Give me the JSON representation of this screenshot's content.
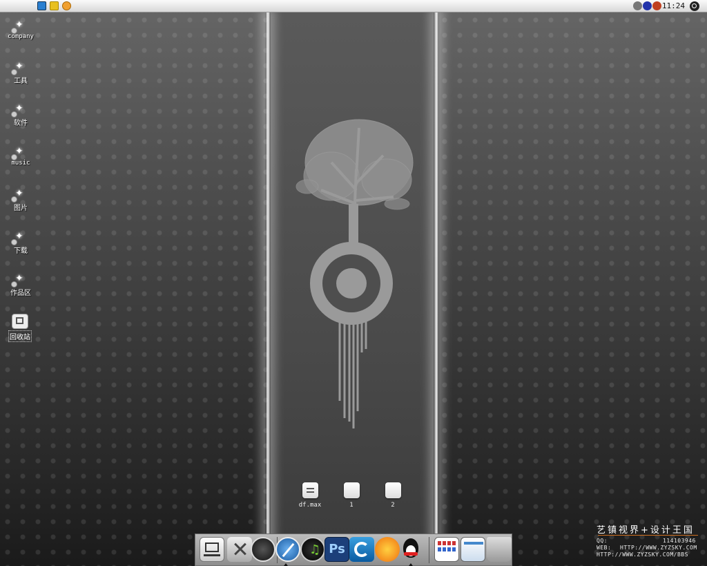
{
  "menubar": {
    "apple_glyph": "",
    "clock": "11:24",
    "left_icons": [
      "3dsmax-icon",
      "fireworks-icon",
      "clock-app-icon"
    ],
    "right_icons": [
      "network-status-icon",
      "input-method-icon",
      "language-icon",
      "spotlight-search-icon"
    ]
  },
  "desktop": {
    "items": [
      {
        "label": "company"
      },
      {
        "label": "工具"
      },
      {
        "label": "软件"
      },
      {
        "label": "music"
      },
      {
        "label": "图片"
      },
      {
        "label": "下载"
      },
      {
        "label": "作品区"
      }
    ],
    "trash": {
      "label": "回收站"
    },
    "center_items": [
      {
        "label": "df.max"
      },
      {
        "label": "1"
      },
      {
        "label": "2"
      }
    ]
  },
  "watermark": {
    "title": "艺镇视界+设计王国",
    "line1_key": "QQ:",
    "line1_val": "114103946",
    "line2_key": "WEB:",
    "line2_val": "HTTP://WWW.ZYZSKY.COM",
    "line3": "HTTP://WWW.ZYZSKY.COM/BBS"
  },
  "dock": {
    "items": [
      "finder-icon",
      "system-tools-icon",
      "dashboard-icon",
      "safari-icon",
      "itunes-icon",
      "photoshop-icon",
      "3dsmax-icon",
      "qq-pet-icon",
      "qq-icon",
      "calculator-widget-icon",
      "desktop-preview-icon",
      "trash-icon"
    ],
    "photoshop_text": "Ps"
  },
  "colors": {
    "menubar": "#e8e8e8",
    "accent_orange": "#d07020",
    "wallpaper_dark": "#2a2a2a"
  }
}
